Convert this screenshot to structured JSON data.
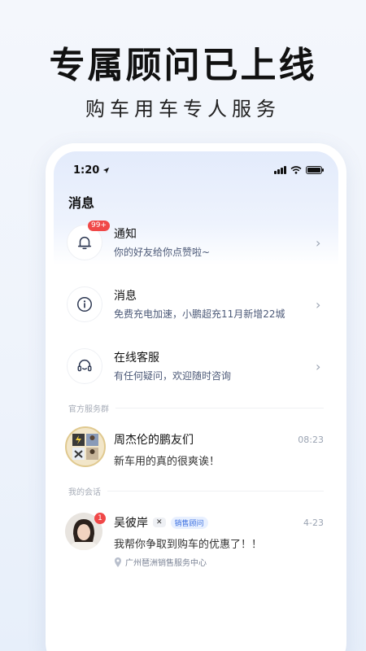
{
  "hero": {
    "title": "专属顾问已上线",
    "subtitle": "购车用车专人服务"
  },
  "status_bar": {
    "time": "1:20"
  },
  "page_title": "消息",
  "rows": [
    {
      "title": "通知",
      "subtitle": "你的好友给你点赞啦~",
      "badge": "99+",
      "icon": "bell-icon"
    },
    {
      "title": "消息",
      "subtitle": "免费充电加速，小鹏超充11月新增22城",
      "icon": "info-icon"
    },
    {
      "title": "在线客服",
      "subtitle": "有任何疑问，欢迎随时咨询",
      "icon": "headset-icon"
    }
  ],
  "sections": {
    "official": "官方服务群",
    "my_chats": "我的会话"
  },
  "group_chat": {
    "name": "周杰伦的鹏友们",
    "time": "08:23",
    "message": "新车用的真的很爽诶！"
  },
  "personal_chat": {
    "name": "吴彼岸",
    "tag": "销售顾问",
    "brand_chip": "✕",
    "time": "4-23",
    "message": "我帮你争取到购车的优惠了！！",
    "location": "广州琶洲销售服务中心",
    "unread": "1"
  },
  "colors": {
    "accent": "#3b6fe0",
    "badge": "#f04848"
  }
}
